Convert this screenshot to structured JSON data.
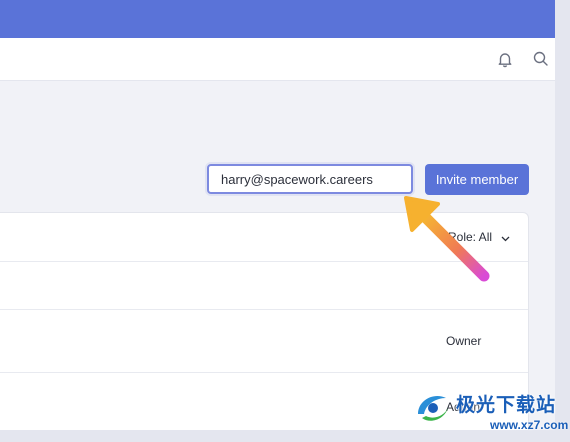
{
  "header": {
    "icons": [
      "bell-icon",
      "search-icon"
    ]
  },
  "invite": {
    "email_value": "harry@spacework.careers",
    "button_label": "Invite member"
  },
  "members": {
    "role_filter_label": "Role: All",
    "rows": [
      {
        "role": ""
      },
      {
        "role": "Owner"
      },
      {
        "role": "Admin"
      }
    ]
  },
  "colors": {
    "brand": "#5a73d8",
    "input_border": "#7d8ae0",
    "arrow_start": "#f5a623",
    "arrow_end": "#d94bd6"
  },
  "watermark": {
    "title": "极光下载站",
    "url": "www.xz7.com"
  }
}
